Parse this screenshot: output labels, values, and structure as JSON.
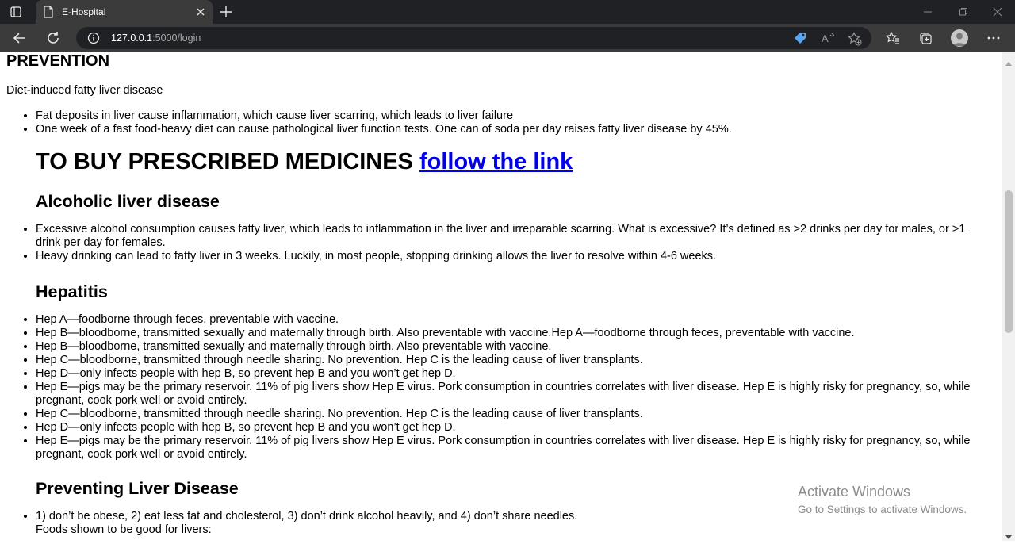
{
  "browser": {
    "tab_title": "E-Hospital",
    "url_host": "127.0.0.1",
    "url_rest": ":5000/login"
  },
  "page": {
    "prevention_heading": "PREVENTION",
    "intro": "Diet-induced fatty liver disease",
    "diet_items": [
      "Fat deposits in liver cause inflammation, which cause liver scarring, which leads to liver failure",
      "One week of a fast food-heavy diet can cause pathological liver function tests. One can of soda per day raises fatty liver disease by 45%."
    ],
    "buy_heading": "TO BUY PRESCRIBED MEDICINES",
    "buy_link": "follow the link",
    "alcoholic_heading": "Alcoholic liver disease",
    "alcoholic_items": [
      "Excessive alcohol consumption causes fatty liver, which leads to inflammation in the liver and irreparable scarring. What is excessive? It’s defined as >2 drinks per day for males, or >1 drink per day for females.",
      "Heavy drinking can lead to fatty liver in 3 weeks. Luckily, in most people, stopping drinking allows the liver to resolve within 4-6 weeks."
    ],
    "hepatitis_heading": "Hepatitis",
    "hepatitis_items": [
      "Hep A—foodborne through feces, preventable with vaccine.",
      "Hep B—bloodborne, transmitted sexually and maternally through birth. Also preventable with vaccine.Hep A—foodborne through feces, preventable with vaccine.",
      "Hep B—bloodborne, transmitted sexually and maternally through birth. Also preventable with vaccine.",
      "Hep C—bloodborne, transmitted through needle sharing. No prevention. Hep C is the leading cause of liver transplants.",
      "Hep D—only infects people with hep B, so prevent hep B and you won’t get hep D.",
      "Hep E—pigs may be the primary reservoir. 11% of pig livers show Hep E virus. Pork consumption in countries correlates with liver disease. Hep E is highly risky for pregnancy, so, while pregnant, cook pork well or avoid entirely.",
      "Hep C—bloodborne, transmitted through needle sharing. No prevention. Hep C is the leading cause of liver transplants.",
      "Hep D—only infects people with hep B, so prevent hep B and you won’t get hep D.",
      "Hep E—pigs may be the primary reservoir. 11% of pig livers show Hep E virus. Pork consumption in countries correlates with liver disease. Hep E is highly risky for pregnancy, so, while pregnant, cook pork well or avoid entirely."
    ],
    "preventing_heading": "Preventing Liver Disease",
    "preventing_items": [
      "1) don’t be obese, 2) eat less fat and cholesterol, 3) don’t drink alcohol heavily, and 4) don’t share needles.",
      "Foods shown to be good for livers:"
    ]
  },
  "watermark": {
    "line1": "Activate Windows",
    "line2": "Go to Settings to activate Windows."
  },
  "colors": {
    "chrome_dark": "#202124",
    "chrome_mid": "#3b3b3b",
    "link": "#0000ee"
  }
}
